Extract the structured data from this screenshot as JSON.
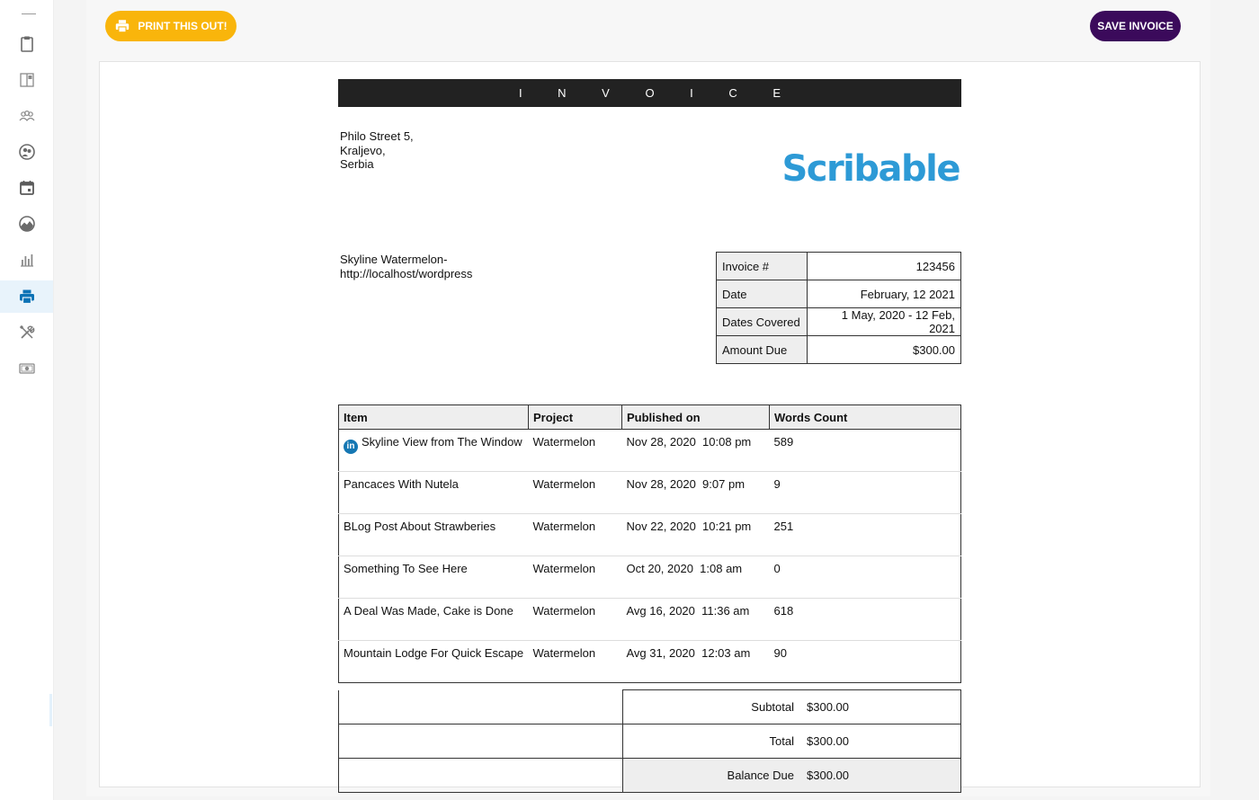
{
  "sidebar": {
    "items": [
      {
        "icon": "clipboard-icon"
      },
      {
        "icon": "book-icon"
      },
      {
        "icon": "team-icon"
      },
      {
        "icon": "users-circle-icon"
      },
      {
        "icon": "calendar-icon"
      },
      {
        "icon": "chart-pie-icon"
      },
      {
        "icon": "bar-chart-icon"
      },
      {
        "icon": "printer-icon"
      },
      {
        "icon": "tools-icon"
      },
      {
        "icon": "money-icon"
      }
    ],
    "active_icon": "printer-icon",
    "active_color": "#0b72b5"
  },
  "toolbar": {
    "print_label": "PRINT THIS OUT!",
    "save_label": "SAVE INVOICE",
    "print_color": "#f9b50b",
    "save_color": "#3b0a5b"
  },
  "invoice": {
    "title": "I N V O I C E",
    "logo_text": "Scribable",
    "logo_color": "#2d9ad6",
    "from_address": [
      "Philo Street 5,",
      "Kraljevo,",
      "Serbia"
    ],
    "client": [
      "Skyline Watermelon-",
      "http://localhost/wordpress"
    ],
    "meta": [
      {
        "label": "Invoice #",
        "value": "123456"
      },
      {
        "label": "Date",
        "value": "February, 12 2021"
      },
      {
        "label": "Dates Covered",
        "value": "1 May, 2020 - 12 Feb, 2021"
      },
      {
        "label": "Amount Due",
        "value": "$300.00"
      }
    ],
    "columns": [
      "Item",
      "Project",
      "Published on",
      "Words Count"
    ],
    "rows": [
      {
        "item": "Skyline View from The Window",
        "project": "Watermelon",
        "published": "Nov 28, 2020  10:08 pm",
        "words": "589",
        "icon": "linkedin-icon"
      },
      {
        "item": "Pancaces With Nutela",
        "project": "Watermelon",
        "published": "Nov 28, 2020  9:07 pm",
        "words": "9"
      },
      {
        "item": "BLog Post About Strawberies",
        "project": "Watermelon",
        "published": "Nov 22, 2020  10:21 pm",
        "words": "251"
      },
      {
        "item": "Something To See Here",
        "project": "Watermelon",
        "published": "Oct 20, 2020  1:08 am",
        "words": "0"
      },
      {
        "item": "A Deal Was Made, Cake is Done",
        "project": "Watermelon",
        "published": "Avg 16, 2020  11:36 am",
        "words": "618"
      },
      {
        "item": "Mountain Lodge For Quick Escape",
        "project": "Watermelon",
        "published": "Avg 31, 2020  12:03 am",
        "words": "90"
      }
    ],
    "totals": [
      {
        "label": "Subtotal",
        "value": "$300.00"
      },
      {
        "label": "Total",
        "value": "$300.00"
      },
      {
        "label": "Balance Due",
        "value": "$300.00"
      }
    ]
  }
}
